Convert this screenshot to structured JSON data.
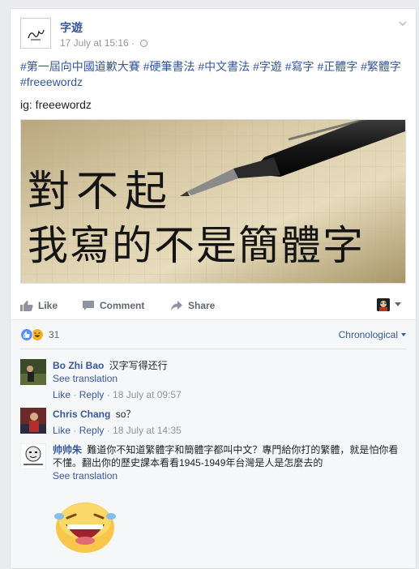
{
  "post": {
    "page_name": "字遊",
    "date": "17 July at 15:16",
    "separator": "·",
    "hashtags": [
      "#第一屆向中國道歉大賽",
      "#硬筆書法",
      "#中文書法",
      "#字遊",
      "#寫字",
      "#正體字",
      "#繁體字",
      "#freeewordz"
    ],
    "ig_line": "ig: freeewordz",
    "photo": {
      "line1": "對不起",
      "line2": "我寫的不是簡體字"
    }
  },
  "actions": {
    "like": "Like",
    "comment": "Comment",
    "share": "Share"
  },
  "reactions": {
    "count": "31",
    "sort_label": "Chronological"
  },
  "comments": [
    {
      "author": "Bo Zhi Bao",
      "text": "汉字写得还行",
      "see_translation": "See translation",
      "like": "Like",
      "reply": "Reply",
      "dot": " · ",
      "time": "18 July at 09:57"
    },
    {
      "author": "Chris Chang",
      "text": "so？",
      "like": "Like",
      "reply": "Reply",
      "dot": " · ",
      "time": "18 July at 14:35"
    },
    {
      "author": "帅帅朱",
      "text": "難道你不知道繁體字和簡體字都叫中文？專門給你打的繁體，就是怕你看不懂。翻出你的歷史課本看看1945-1949年台灣是人是怎麼去的",
      "see_translation": "See translation"
    }
  ],
  "colors": {
    "link": "#365899",
    "muted": "#90949c",
    "background": "#e9ebee"
  }
}
